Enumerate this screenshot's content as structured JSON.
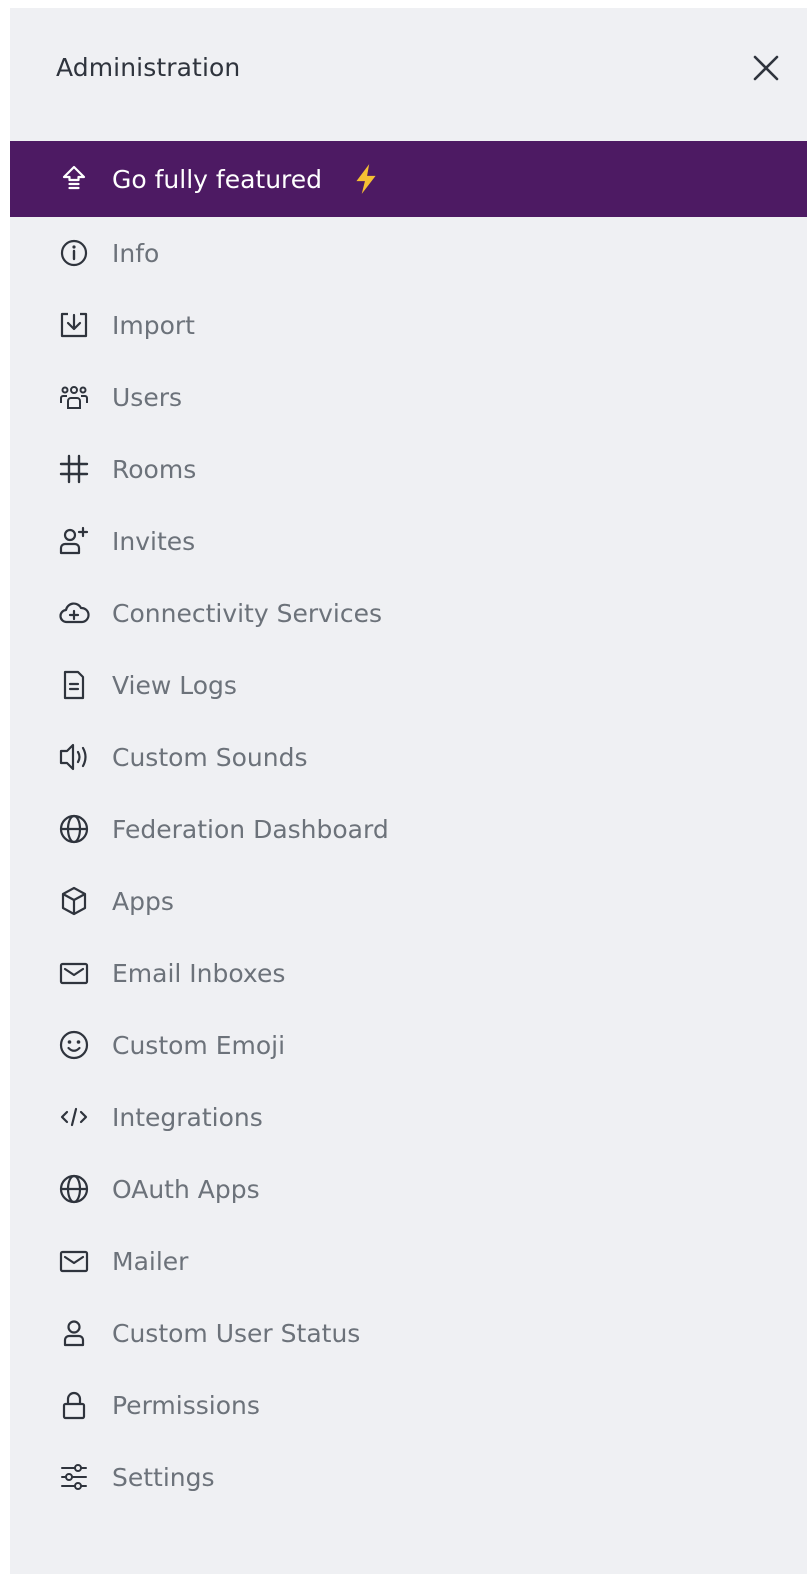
{
  "sidebar": {
    "title": "Administration",
    "close_icon": "close-icon",
    "featured": {
      "label": "Go fully featured",
      "icon": "upgrade-arrow-icon",
      "badge_icon": "lightning-bolt-icon",
      "background": "#4d1a63",
      "badge_color": "#f5c033"
    },
    "items": [
      {
        "label": "Info",
        "icon": "info-icon"
      },
      {
        "label": "Import",
        "icon": "import-icon"
      },
      {
        "label": "Users",
        "icon": "users-icon"
      },
      {
        "label": "Rooms",
        "icon": "hashtag-icon"
      },
      {
        "label": "Invites",
        "icon": "user-plus-icon"
      },
      {
        "label": "Connectivity Services",
        "icon": "cloud-plus-icon"
      },
      {
        "label": "View Logs",
        "icon": "document-icon"
      },
      {
        "label": "Custom Sounds",
        "icon": "speaker-icon"
      },
      {
        "label": "Federation Dashboard",
        "icon": "globe-icon"
      },
      {
        "label": "Apps",
        "icon": "cube-icon"
      },
      {
        "label": "Email Inboxes",
        "icon": "mail-icon"
      },
      {
        "label": "Custom Emoji",
        "icon": "emoji-icon"
      },
      {
        "label": "Integrations",
        "icon": "code-icon"
      },
      {
        "label": "OAuth Apps",
        "icon": "globe-icon"
      },
      {
        "label": "Mailer",
        "icon": "mail-icon"
      },
      {
        "label": "Custom User Status",
        "icon": "user-icon"
      },
      {
        "label": "Permissions",
        "icon": "lock-icon"
      },
      {
        "label": "Settings",
        "icon": "sliders-icon"
      }
    ]
  }
}
